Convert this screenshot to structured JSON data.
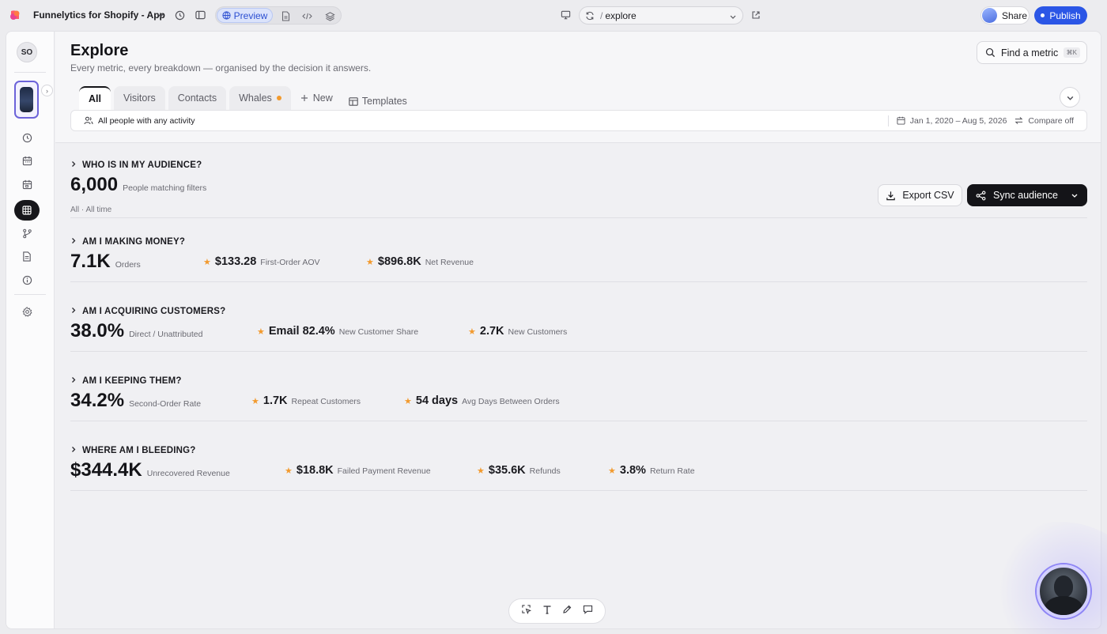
{
  "topbar": {
    "project_name": "Funnelytics for Shopify - App",
    "preview_label": "Preview",
    "url_slash": "/",
    "url_path": "explore",
    "share_label": "Share",
    "publish_label": "Publish"
  },
  "sidebar": {
    "avatar_initials": "SO"
  },
  "header": {
    "title": "Explore",
    "subtitle": "Every metric, every breakdown — organised by the decision it answers.",
    "find_metric_label": "Find a metric",
    "find_metric_shortcut": "⌘K",
    "tabs": [
      {
        "label": "All"
      },
      {
        "label": "Visitors"
      },
      {
        "label": "Contacts"
      },
      {
        "label": "Whales"
      }
    ],
    "new_label": "New",
    "templates_label": "Templates",
    "filter_label": "All people with any activity",
    "date_range": "Jan 1, 2020 – Aug 5, 2026",
    "compare_label": "Compare off"
  },
  "sections": {
    "audience": {
      "heading": "WHO IS IN MY AUDIENCE?",
      "primary_value": "6,000",
      "primary_label": "People matching filters",
      "meta": "All · All time",
      "export_label": "Export CSV",
      "sync_label": "Sync audience"
    },
    "money": {
      "heading": "AM I MAKING MONEY?",
      "primary_value": "7.1K",
      "primary_label": "Orders",
      "secondary": [
        {
          "value": "$133.28",
          "label": "First-Order AOV"
        },
        {
          "value": "$896.8K",
          "label": "Net Revenue"
        }
      ]
    },
    "acquiring": {
      "heading": "AM I ACQUIRING CUSTOMERS?",
      "primary_value": "38.0%",
      "primary_label": "Direct / Unattributed",
      "secondary": [
        {
          "value": "Email 82.4%",
          "label": "New Customer Share"
        },
        {
          "value": "2.7K",
          "label": "New Customers"
        }
      ]
    },
    "keeping": {
      "heading": "AM I KEEPING THEM?",
      "primary_value": "34.2%",
      "primary_label": "Second-Order Rate",
      "secondary": [
        {
          "value": "1.7K",
          "label": "Repeat Customers"
        },
        {
          "value": "54 days",
          "label": "Avg Days Between Orders"
        }
      ]
    },
    "bleeding": {
      "heading": "WHERE AM I BLEEDING?",
      "primary_value": "$344.4K",
      "primary_label": "Unrecovered Revenue",
      "secondary": [
        {
          "value": "$18.8K",
          "label": "Failed Payment Revenue"
        },
        {
          "value": "$35.6K",
          "label": "Refunds"
        },
        {
          "value": "3.8%",
          "label": "Return Rate"
        }
      ]
    }
  },
  "colors": {
    "accent_blue": "#2b56e6",
    "star_orange": "#f29a2e",
    "dark": "#141418"
  }
}
